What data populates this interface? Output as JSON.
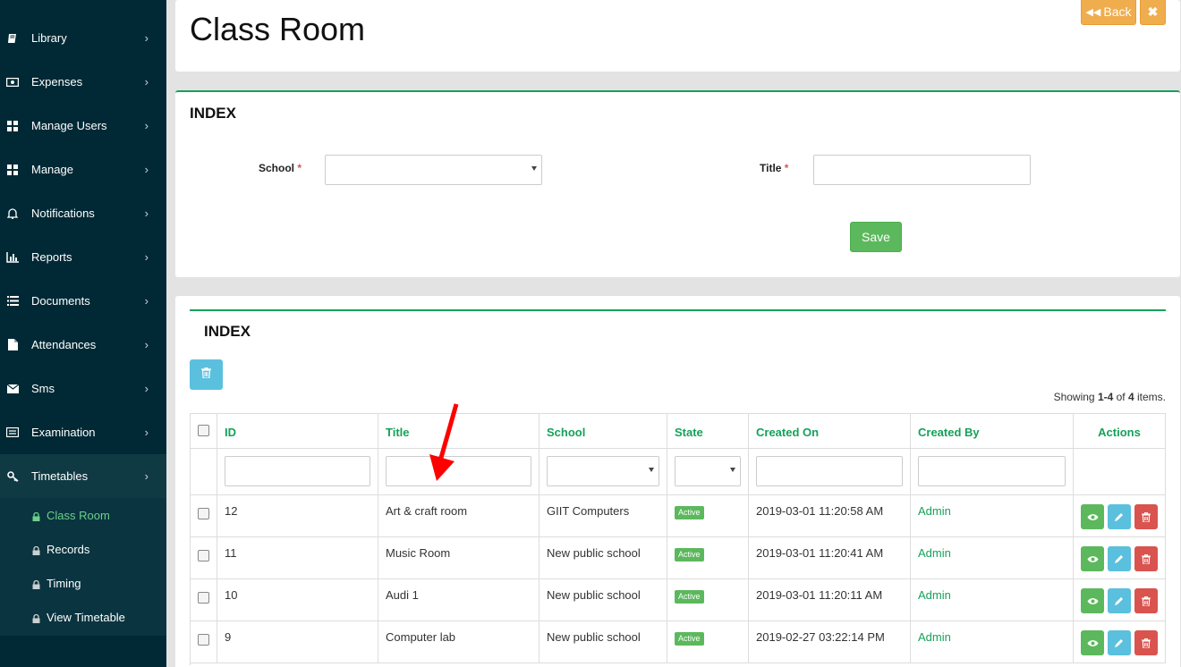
{
  "sidebar": {
    "items": [
      {
        "label": "Library",
        "icon": "book-icon"
      },
      {
        "label": "Expenses",
        "icon": "money-icon"
      },
      {
        "label": "Manage Users",
        "icon": "th-large-icon"
      },
      {
        "label": "Manage",
        "icon": "th-large-icon"
      },
      {
        "label": "Notifications",
        "icon": "bell-icon"
      },
      {
        "label": "Reports",
        "icon": "bar-chart-icon"
      },
      {
        "label": "Documents",
        "icon": "list-icon"
      },
      {
        "label": "Attendances",
        "icon": "file-icon"
      },
      {
        "label": "Sms",
        "icon": "envelope-icon"
      },
      {
        "label": "Examination",
        "icon": "card-icon"
      },
      {
        "label": "Timetables",
        "icon": "key-icon"
      }
    ],
    "chevron": "›",
    "subitems": [
      {
        "label": "Class Room"
      },
      {
        "label": "Records"
      },
      {
        "label": "Timing"
      },
      {
        "label": "View Timetable"
      }
    ]
  },
  "header": {
    "title": "Class Room",
    "back_label": "Back",
    "close_label": "✖"
  },
  "form": {
    "heading": "INDEX",
    "school_label": "School",
    "title_label": "Title",
    "required_mark": "*",
    "school_value": "",
    "title_value": "",
    "save_label": "Save"
  },
  "grid": {
    "heading": "INDEX",
    "summary": {
      "prefix": "Showing ",
      "range": "1-4",
      "mid": " of ",
      "total": "4",
      "suffix": " items."
    },
    "columns": [
      "ID",
      "Title",
      "School",
      "State",
      "Created On",
      "Created By",
      "Actions"
    ],
    "rows": [
      {
        "id": "12",
        "title": "Art & craft room",
        "school": "GIIT Computers",
        "state": "Active",
        "created_on": "2019-03-01 11:20:58 AM",
        "created_by": "Admin"
      },
      {
        "id": "11",
        "title": "Music Room",
        "school": "New public school",
        "state": "Active",
        "created_on": "2019-03-01 11:20:41 AM",
        "created_by": "Admin"
      },
      {
        "id": "10",
        "title": "Audi 1",
        "school": "New public school",
        "state": "Active",
        "created_on": "2019-03-01 11:20:11 AM",
        "created_by": "Admin"
      },
      {
        "id": "9",
        "title": "Computer lab",
        "school": "New public school",
        "state": "Active",
        "created_on": "2019-02-27 03:22:14 PM",
        "created_by": "Admin"
      }
    ]
  },
  "colors": {
    "sidebar_bg": "#012935",
    "accent_green": "#15a15a",
    "save_green": "#5cb85c",
    "info_blue": "#5bc0de",
    "danger_red": "#d9534f",
    "warning_orange": "#f0ad4e",
    "annotation_arrow": "#ff0000"
  }
}
